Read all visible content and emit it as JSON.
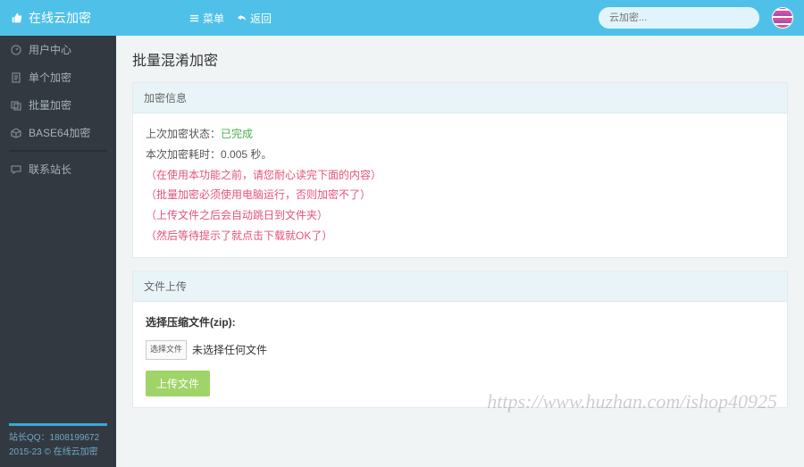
{
  "brand": "在线云加密",
  "topnav": {
    "menu": "菜单",
    "back": "返回"
  },
  "search_placeholder": "云加密...",
  "sidebar": {
    "items": [
      {
        "label": "用户中心"
      },
      {
        "label": "单个加密"
      },
      {
        "label": "批量加密"
      },
      {
        "label": "BASE64加密"
      },
      {
        "label": "联系站长"
      }
    ],
    "footer_line1": "站长QQ：1808199672",
    "footer_line2": "2015-23 © 在线云加密"
  },
  "page_title": "批量混淆加密",
  "panel_info": {
    "head": "加密信息",
    "status_label": "上次加密状态：",
    "status_value": "已完成",
    "duration_label": "本次加密耗时：",
    "duration_value": "0.005 秒。",
    "warn1": "（在使用本功能之前，请您耐心读完下面的内容）",
    "warn2": "（批量加密必须使用电脑运行，否则加密不了）",
    "warn3": "（上传文件之后会自动跳日到文件夹）",
    "warn4": "（然后等待提示了就点击下载就OK了）"
  },
  "panel_upload": {
    "head": "文件上传",
    "select_label": "选择压缩文件(zip):",
    "choose_btn": "选择文件",
    "no_file": "未选择任何文件",
    "upload_btn": "上传文件"
  },
  "watermark": "https://www.huzhan.com/ishop40925"
}
